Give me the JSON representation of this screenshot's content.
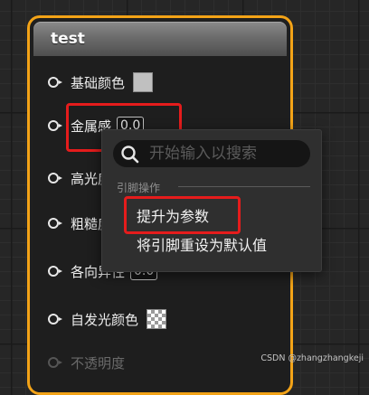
{
  "node": {
    "title": "test",
    "pins": [
      {
        "label": "基础颜色",
        "widget": "color-swatch",
        "color": "#c0c0c0"
      },
      {
        "label": "金属感",
        "value": "0.0"
      },
      {
        "label": "高光度"
      },
      {
        "label": "粗糙度"
      },
      {
        "label": "各向异性",
        "value": "0.0"
      },
      {
        "label": "自发光颜色",
        "widget": "checker-swatch"
      },
      {
        "label": "不透明度",
        "disabled": true
      }
    ]
  },
  "context_menu": {
    "search": {
      "placeholder": "开始输入以搜索",
      "value": ""
    },
    "section_title": "引脚操作",
    "items": [
      {
        "label": "提升为参数"
      },
      {
        "label": "将引脚重设为默认值"
      }
    ]
  },
  "colors": {
    "node_border": "#f3a317",
    "highlight": "#e51c1c",
    "menu_bg": "#2f2f2f"
  },
  "watermark": "CSDN @zhangzhangkeji"
}
